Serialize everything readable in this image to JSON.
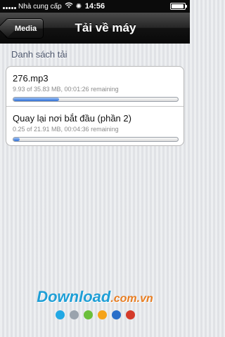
{
  "status_bar": {
    "carrier": "Nhà cung cấp",
    "time": "14:56",
    "battery_level": 0.95,
    "wifi_icon": "wifi-icon",
    "activity_icon": "spinner-icon"
  },
  "nav": {
    "back_label": "Media",
    "title": "Tải về máy"
  },
  "section": {
    "header": "Danh sách tải"
  },
  "downloads": [
    {
      "name": "276.mp3",
      "info": "9.93 of 35.83 MB, 00:01:26 remaining",
      "progress": 0.277
    },
    {
      "name": "Quay lại nơi bắt đầu (phần 2)",
      "info": "0.25 of 21.91 MB, 00:04:36 remaining",
      "progress": 0.04
    }
  ],
  "watermark": {
    "brand": "Download",
    "suffix": ".com.vn",
    "dot_colors": [
      "#22a8e4",
      "#9aa3ad",
      "#6bbf3a",
      "#f5a31a",
      "#2a6fc9",
      "#d43b2b"
    ]
  },
  "colors": {
    "progress_fill": "#2f6fd6",
    "navbar": "#1a1a1a",
    "section_header": "#4c566c"
  }
}
